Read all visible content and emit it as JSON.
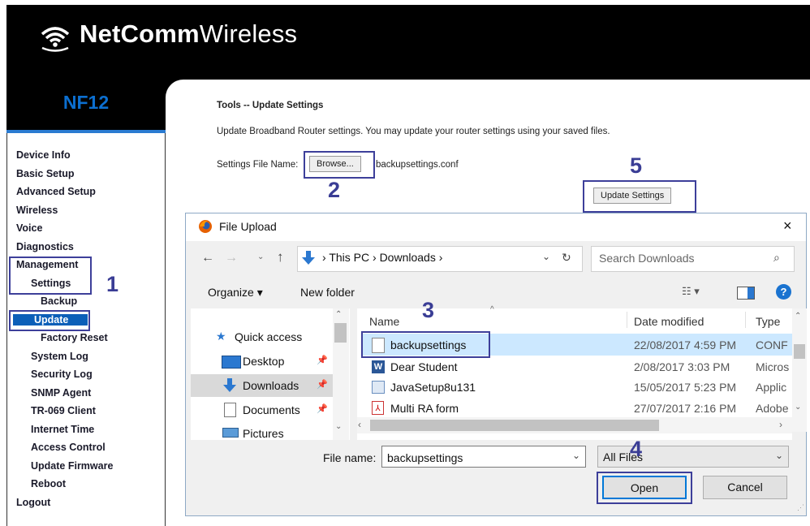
{
  "brand": {
    "name_bold": "NetComm",
    "name_light": "Wireless",
    "model": "NF12"
  },
  "nav": [
    {
      "label": "Device Info",
      "indent": 0
    },
    {
      "label": "Basic Setup",
      "indent": 0
    },
    {
      "label": "Advanced Setup",
      "indent": 0
    },
    {
      "label": "Wireless",
      "indent": 0
    },
    {
      "label": "Voice",
      "indent": 0
    },
    {
      "label": "Diagnostics",
      "indent": 0
    },
    {
      "label": "Management",
      "indent": 0
    },
    {
      "label": "Settings",
      "indent": 1
    },
    {
      "label": "Backup",
      "indent": 2
    },
    {
      "label": "Update",
      "indent": 2,
      "selected": true
    },
    {
      "label": "Factory Reset",
      "indent": 2
    },
    {
      "label": "System Log",
      "indent": 1
    },
    {
      "label": "Security Log",
      "indent": 1
    },
    {
      "label": "SNMP Agent",
      "indent": 1
    },
    {
      "label": "TR-069 Client",
      "indent": 1
    },
    {
      "label": "Internet Time",
      "indent": 1
    },
    {
      "label": "Access Control",
      "indent": 1
    },
    {
      "label": "Update Firmware",
      "indent": 1
    },
    {
      "label": "Reboot",
      "indent": 1
    },
    {
      "label": "Logout",
      "indent": 0
    }
  ],
  "page": {
    "title": "Tools -- Update Settings",
    "description": "Update Broadband Router settings. You may update your router settings using your saved files.",
    "file_label": "Settings File Name:",
    "browse_label": "Browse...",
    "file_value": "backupsettings.conf",
    "update_button": "Update Settings"
  },
  "steps": [
    "1",
    "2",
    "3",
    "4",
    "5"
  ],
  "dialog": {
    "title": "File Upload",
    "close": "×",
    "breadcrumb": [
      "This PC",
      "Downloads"
    ],
    "search_placeholder": "Search Downloads",
    "organize": "Organize ▾",
    "new_folder": "New folder",
    "tree": [
      "Quick access",
      "Desktop",
      "Downloads",
      "Documents",
      "Pictures"
    ],
    "columns": {
      "name": "Name",
      "date": "Date modified",
      "type": "Type"
    },
    "files": [
      {
        "name": "backupsettings",
        "date": "22/08/2017 4:59 PM",
        "type": "CONF",
        "selected": true
      },
      {
        "name": "Dear Student",
        "date": "2/08/2017 3:03 PM",
        "type": "Micros"
      },
      {
        "name": "JavaSetup8u131",
        "date": "15/05/2017 5:23 PM",
        "type": "Applic"
      },
      {
        "name": "Multi RA form",
        "date": "27/07/2017 2:16 PM",
        "type": "Adobe"
      }
    ],
    "file_name_label": "File name:",
    "file_name_value": "backupsettings",
    "file_type": "All Files",
    "open": "Open",
    "cancel": "Cancel"
  },
  "colors": {
    "annotation": "#3d3f9a",
    "accent": "#0c6fd0",
    "selected": "#cce8ff"
  }
}
